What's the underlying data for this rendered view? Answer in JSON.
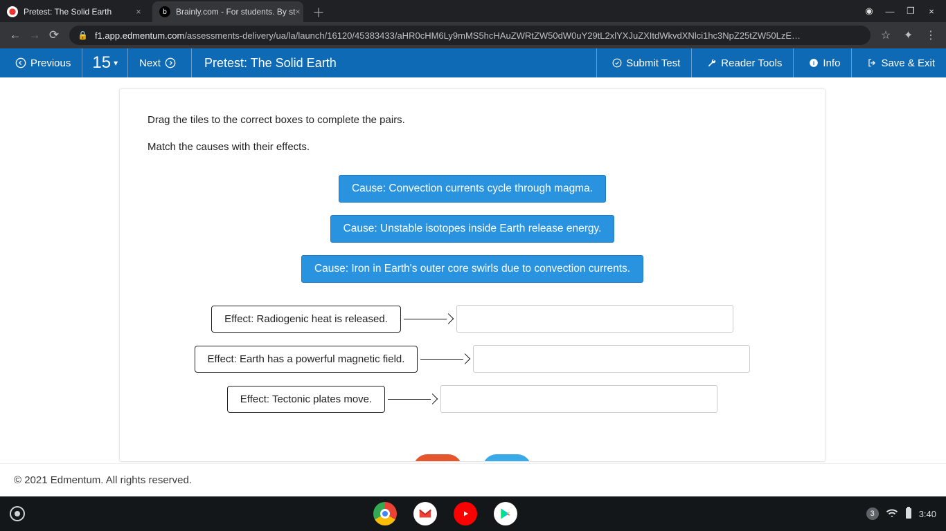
{
  "browser": {
    "tabs": [
      {
        "title": "Pretest: The Solid Earth",
        "active": true
      },
      {
        "title": "Brainly.com - For students. By st",
        "active": false
      }
    ],
    "url_host": "f1.app.edmentum.com",
    "url_path": "/assessments-delivery/ua/la/launch/16120/45383433/aHR0cHM6Ly9mMS5hcHAuZWRtZW50dW0uY29tL2xlYXJuZXItdWkvdXNlci1hc3NpZ25tZW50LzE…"
  },
  "appbar": {
    "previous": "Previous",
    "question_number": "15",
    "next": "Next",
    "title": "Pretest: The Solid Earth",
    "submit": "Submit Test",
    "reader": "Reader Tools",
    "info": "Info",
    "save_exit": "Save & Exit"
  },
  "question": {
    "instruction1": "Drag the tiles to the correct boxes to complete the pairs.",
    "instruction2": "Match the causes with their effects.",
    "tiles": [
      "Cause: Convection currents cycle through magma.",
      "Cause: Unstable isotopes inside Earth release energy.",
      "Cause: Iron in Earth's outer core swirls due to convection currents."
    ],
    "effects": [
      "Effect: Radiogenic heat is released.",
      "Effect: Earth has a powerful magnetic field.",
      "Effect: Tectonic plates move."
    ]
  },
  "footer": {
    "copyright": "© 2021 Edmentum. All rights reserved."
  },
  "shelf": {
    "notif_count": "3",
    "clock": "3:40"
  }
}
